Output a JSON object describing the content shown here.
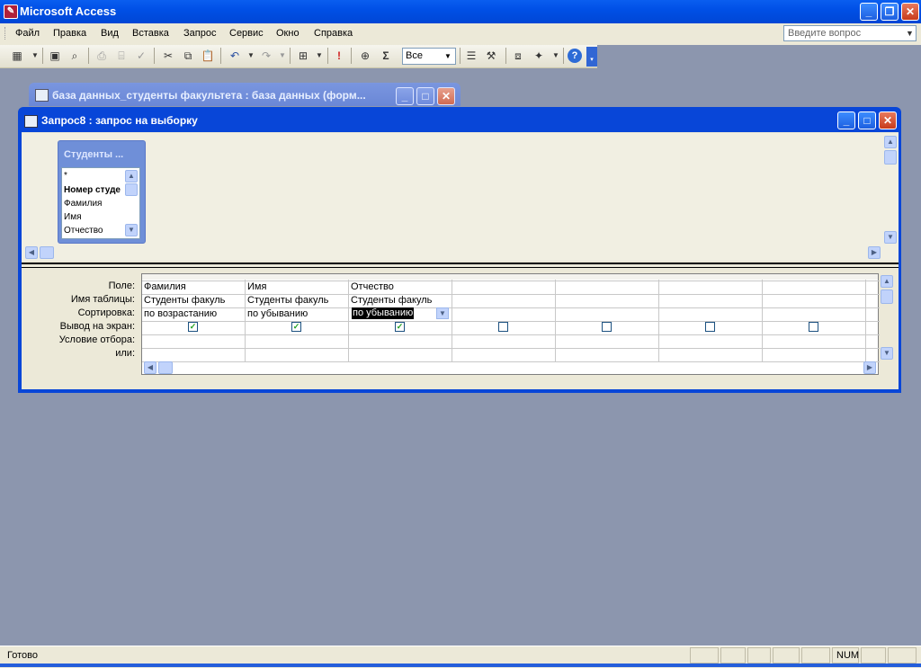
{
  "app": {
    "title": "Microsoft Access",
    "icon": "access-key-icon"
  },
  "menu": {
    "items": [
      "Файл",
      "Правка",
      "Вид",
      "Вставка",
      "Запрос",
      "Сервис",
      "Окно",
      "Справка"
    ],
    "ask_placeholder": "Введите вопрос"
  },
  "toolbar": {
    "filter_value": "Все"
  },
  "background_window": {
    "title": "база данных_студенты факультета : база данных (форм..."
  },
  "query_window": {
    "title": "Запрос8 : запрос на выборку"
  },
  "field_list": {
    "title": "Студенты ...",
    "fields": [
      "*",
      "Номер студе",
      "Фамилия",
      "Имя",
      "Отчество"
    ]
  },
  "grid": {
    "row_labels": [
      "Поле:",
      "Имя таблицы:",
      "Сортировка:",
      "Вывод на экран:",
      "Условие отбора:",
      "или:"
    ],
    "columns": [
      {
        "field": "Фамилия",
        "table": "Студенты факуль",
        "sort": "по возрастанию",
        "show": true
      },
      {
        "field": "Имя",
        "table": "Студенты факуль",
        "sort": "по убыванию",
        "show": true
      },
      {
        "field": "Отчество",
        "table": "Студенты факуль",
        "sort": "по убыванию",
        "show": true
      },
      {
        "field": "",
        "table": "",
        "sort": "",
        "show": false
      },
      {
        "field": "",
        "table": "",
        "sort": "",
        "show": false
      },
      {
        "field": "",
        "table": "",
        "sort": "",
        "show": false
      },
      {
        "field": "",
        "table": "",
        "sort": "",
        "show": false
      }
    ]
  },
  "status": {
    "text": "Готово",
    "num": "NUM"
  }
}
